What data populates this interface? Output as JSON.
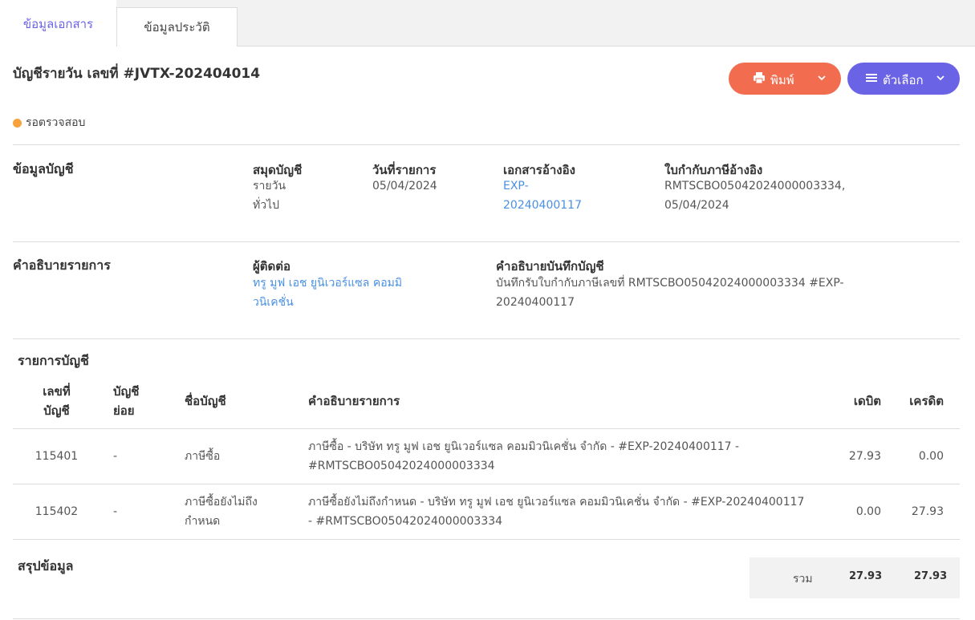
{
  "tabs": [
    {
      "label": "ข้อมูลเอกสาร",
      "active": true
    },
    {
      "label": "ข้อมูลประวัติ",
      "active": false
    }
  ],
  "header": {
    "title": "บัญชีรายวัน เลขที่ #JVTX-202404014",
    "print_label": "พิมพ์",
    "options_label": "ตัวเลือก",
    "status": "รอตรวจสอบ",
    "status_color": "#f7a23c",
    "print_color": "#f26d4f",
    "options_color": "#6b63e6"
  },
  "account_info": {
    "section_title": "ข้อมูลบัญชี",
    "journal_label": "สมุดบัญชี",
    "journal_value_1": "รายวัน",
    "journal_value_2": "ทั่วไป",
    "date_label": "วันที่รายการ",
    "date_value": "05/04/2024",
    "ref_doc_label": "เอกสารอ้างอิง",
    "ref_doc_value_1": "EXP-",
    "ref_doc_value_2": "20240400117",
    "tax_ref_label": "ใบกำกับภาษีอ้างอิง",
    "tax_ref_value_1": "RMTSCBO05042024000003334,",
    "tax_ref_value_2": "05/04/2024"
  },
  "description": {
    "section_title": "คำอธิบายรายการ",
    "contact_label": "ผู้ติดต่อ",
    "contact_value_1": "ทรู มูฟ เอช ยูนิเวอร์แซล คอมมิ",
    "contact_value_2": "วนิเคชั่น",
    "memo_label": "คำอธิบายบันทึกบัญชี",
    "memo_value_1": "บันทึกรับใบกำกับภาษีเลขที่ RMTSCBO05042024000003334 #EXP-",
    "memo_value_2": "20240400117"
  },
  "entries": {
    "section_title": "รายการบัญชี",
    "headers": {
      "account_no_1": "เลขที่",
      "account_no_2": "บัญชี",
      "sub_1": "บัญชี",
      "sub_2": "ย่อย",
      "name": "ชื่อบัญชี",
      "desc": "คำอธิบายรายการ",
      "debit": "เดบิต",
      "credit": "เครดิต"
    },
    "rows": [
      {
        "account_no": "115401",
        "sub": "-",
        "name_1": "ภาษีซื้อ",
        "name_2": "",
        "desc_1": "ภาษีซื้อ - บริษัท ทรู มูฟ เอช ยูนิเวอร์แซล คอมมิวนิเคชั่น จำกัด - #EXP-20240400117 -",
        "desc_2": "#RMTSCBO05042024000003334",
        "debit": "27.93",
        "credit": "0.00"
      },
      {
        "account_no": "115402",
        "sub": "-",
        "name_1": "ภาษีซื้อยังไม่ถึง",
        "name_2": "กำหนด",
        "desc_1": "ภาษีซื้อยังไม่ถึงกำหนด - บริษัท ทรู มูฟ เอช ยูนิเวอร์แซล คอมมิวนิเคชั่น จำกัด - #EXP-20240400117",
        "desc_2": "- #RMTSCBO05042024000003334",
        "debit": "0.00",
        "credit": "27.93"
      }
    ]
  },
  "summary": {
    "section_title": "สรุปข้อมูล",
    "total_label": "รวม",
    "total_debit": "27.93",
    "total_credit": "27.93"
  }
}
